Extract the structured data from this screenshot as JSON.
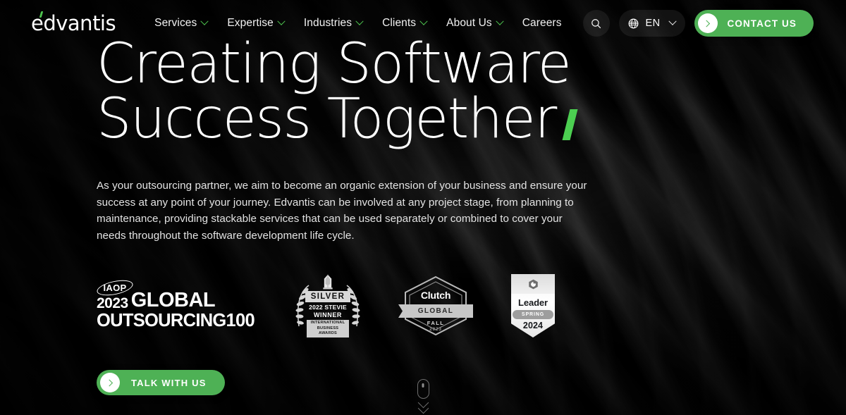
{
  "brand": {
    "logo_text": "edvantis",
    "accent_color": "#4ec44f"
  },
  "nav": {
    "items": [
      {
        "label": "Services",
        "has_dropdown": true
      },
      {
        "label": "Expertise",
        "has_dropdown": true
      },
      {
        "label": "Industries",
        "has_dropdown": true
      },
      {
        "label": "Clients",
        "has_dropdown": true
      },
      {
        "label": "About Us",
        "has_dropdown": true
      },
      {
        "label": "Careers",
        "has_dropdown": false
      }
    ]
  },
  "header_actions": {
    "search_icon": "search-icon",
    "globe_icon": "globe-icon",
    "language_code": "EN",
    "language_chevron_icon": "chevron-down-icon",
    "contact_button_label": "CONTACT US",
    "contact_button_color": "#4eb155"
  },
  "hero": {
    "headline_line1": "Creating Software",
    "headline_line2": "Success Together",
    "headline_accent": "slash-accent",
    "headline_accent_color": "#4ccf51",
    "paragraph": "As your outsourcing partner, we aim to become an organic extension of your business and ensure your success at any point of your journey. Edvantis can be involved at any project stage, from planning to maintenance, providing stackable services that can be used separately or combined to cover your needs throughout the software development life cycle.",
    "cta_label": "TALK WITH US"
  },
  "badges": [
    {
      "id": "iaop-global-outsourcing",
      "org": "IAOP",
      "year": "2023",
      "line1": "GLOBAL",
      "line2": "OUTSOURCING100"
    },
    {
      "id": "stevie-award",
      "level": "SILVER",
      "year": "2022 STEVIE",
      "status": "WINNER",
      "org": "INTERNATIONAL BUSINESS AWARDS"
    },
    {
      "id": "clutch-global",
      "brand": "Clutch",
      "ribbon": "GLOBAL",
      "season": "FALL",
      "year": "2023"
    },
    {
      "id": "g2-leader",
      "logo": "g2-logo-icon",
      "rank": "Leader",
      "season": "SPRING",
      "year": "2024"
    }
  ],
  "scroll_indicator": {
    "mouse_icon": "mouse-scroll-icon",
    "chevron_icon": "chevron-down-icon"
  }
}
